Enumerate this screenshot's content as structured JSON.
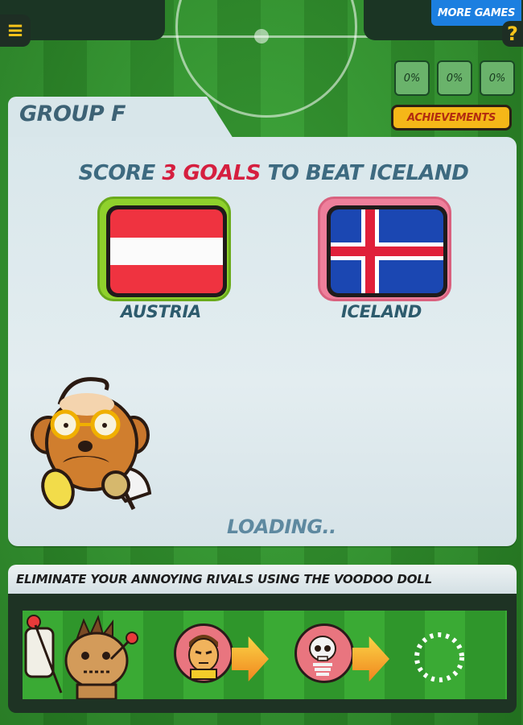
{
  "header": {
    "more_games_label": "MORE GAMES",
    "help_label": "?",
    "menu_label": "≡",
    "progress": [
      {
        "label": "0%",
        "value": 0
      },
      {
        "label": "0%",
        "value": 0
      },
      {
        "label": "0%",
        "value": 0
      }
    ]
  },
  "group": {
    "title": "GROUP F"
  },
  "achievements_label": "ACHIEVEMENTS",
  "match": {
    "objective_prefix": "SCORE",
    "objective_goals": "3 GOALS",
    "objective_suffix": "TO BEAT ICELAND",
    "home_team": "AUSTRIA",
    "away_team": "ICELAND"
  },
  "status": "LOADING..",
  "tip": "ELIMINATE YOUR ANNOYING RIVALS USING THE VOODOO DOLL",
  "colors": {
    "home_frame": "#8fd12c",
    "away_frame": "#ee7f9b",
    "austria_red": "#ef3340",
    "iceland_blue": "#1b47b2",
    "iceland_red": "#e0203a",
    "accent_red": "#d51f3f",
    "button_yellow": "#f5b718",
    "more_games_blue": "#1c7fe0"
  }
}
